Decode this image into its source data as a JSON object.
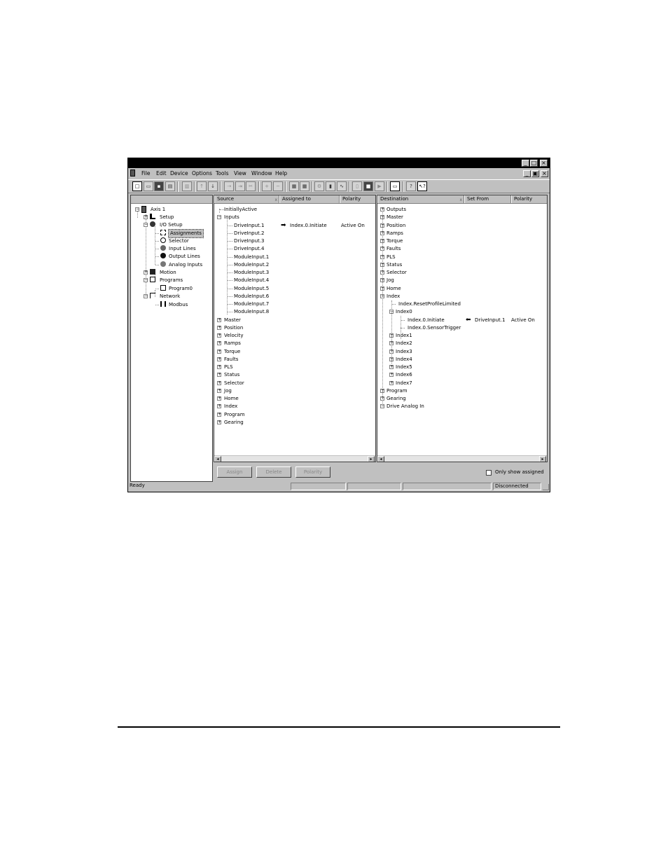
{
  "menu": {
    "items": [
      "File",
      "Edit",
      "Device",
      "Options",
      "Tools",
      "View",
      "Window",
      "Help"
    ]
  },
  "window_controls": {
    "minimize": "_",
    "maximize": "□",
    "close": "×",
    "restore": "▣"
  },
  "tree": {
    "items": [
      {
        "label": "Axis 1",
        "icon": "drive-icon"
      },
      {
        "label": "Setup",
        "icon": "setup-icon"
      },
      {
        "label": "I/O Setup",
        "icon": "io-setup-icon"
      },
      {
        "label": "Assignments",
        "icon": "assignments-icon"
      },
      {
        "label": "Selector",
        "icon": "selector-icon"
      },
      {
        "label": "Input Lines",
        "icon": "input-lines-icon"
      },
      {
        "label": "Output Lines",
        "icon": "output-lines-icon"
      },
      {
        "label": "Analog Inputs",
        "icon": "analog-inputs-icon"
      },
      {
        "label": "Motion",
        "icon": "motion-icon"
      },
      {
        "label": "Programs",
        "icon": "programs-icon"
      },
      {
        "label": "Program0",
        "icon": "program-icon"
      },
      {
        "label": "Network",
        "icon": "network-icon"
      },
      {
        "label": "Modbus",
        "icon": "modbus-icon"
      }
    ]
  },
  "source_panel": {
    "columns": [
      "Source",
      "Assigned to",
      "Polarity"
    ],
    "rows": [
      {
        "label": "InitiallyActive",
        "assigned": "",
        "polarity": ""
      },
      {
        "label": "Inputs",
        "assigned": "",
        "polarity": ""
      },
      {
        "label": "DriveInput.1",
        "assigned": "Index.0.Initiate",
        "polarity": "Active On"
      },
      {
        "label": "DriveInput.2",
        "assigned": "",
        "polarity": ""
      },
      {
        "label": "DriveInput.3",
        "assigned": "",
        "polarity": ""
      },
      {
        "label": "DriveInput.4",
        "assigned": "",
        "polarity": ""
      },
      {
        "label": "ModuleInput.1",
        "assigned": "",
        "polarity": ""
      },
      {
        "label": "ModuleInput.2",
        "assigned": "",
        "polarity": ""
      },
      {
        "label": "ModuleInput.3",
        "assigned": "",
        "polarity": ""
      },
      {
        "label": "ModuleInput.4",
        "assigned": "",
        "polarity": ""
      },
      {
        "label": "ModuleInput.5",
        "assigned": "",
        "polarity": ""
      },
      {
        "label": "ModuleInput.6",
        "assigned": "",
        "polarity": ""
      },
      {
        "label": "ModuleInput.7",
        "assigned": "",
        "polarity": ""
      },
      {
        "label": "ModuleInput.8",
        "assigned": "",
        "polarity": ""
      },
      {
        "label": "Master",
        "assigned": "",
        "polarity": ""
      },
      {
        "label": "Position",
        "assigned": "",
        "polarity": ""
      },
      {
        "label": "Velocity",
        "assigned": "",
        "polarity": ""
      },
      {
        "label": "Ramps",
        "assigned": "",
        "polarity": ""
      },
      {
        "label": "Torque",
        "assigned": "",
        "polarity": ""
      },
      {
        "label": "Faults",
        "assigned": "",
        "polarity": ""
      },
      {
        "label": "PLS",
        "assigned": "",
        "polarity": ""
      },
      {
        "label": "Status",
        "assigned": "",
        "polarity": ""
      },
      {
        "label": "Selector",
        "assigned": "",
        "polarity": ""
      },
      {
        "label": "Jog",
        "assigned": "",
        "polarity": ""
      },
      {
        "label": "Home",
        "assigned": "",
        "polarity": ""
      },
      {
        "label": "Index",
        "assigned": "",
        "polarity": ""
      },
      {
        "label": "Program",
        "assigned": "",
        "polarity": ""
      },
      {
        "label": "Gearing",
        "assigned": "",
        "polarity": ""
      }
    ]
  },
  "destination_panel": {
    "columns": [
      "Destination",
      "Set From",
      "Polarity"
    ],
    "rows": [
      {
        "label": "Outputs",
        "from": "",
        "polarity": ""
      },
      {
        "label": "Master",
        "from": "",
        "polarity": ""
      },
      {
        "label": "Position",
        "from": "",
        "polarity": ""
      },
      {
        "label": "Ramps",
        "from": "",
        "polarity": ""
      },
      {
        "label": "Torque",
        "from": "",
        "polarity": ""
      },
      {
        "label": "Faults",
        "from": "",
        "polarity": ""
      },
      {
        "label": "PLS",
        "from": "",
        "polarity": ""
      },
      {
        "label": "Status",
        "from": "",
        "polarity": ""
      },
      {
        "label": "Selector",
        "from": "",
        "polarity": ""
      },
      {
        "label": "Jog",
        "from": "",
        "polarity": ""
      },
      {
        "label": "Home",
        "from": "",
        "polarity": ""
      },
      {
        "label": "Index",
        "from": "",
        "polarity": ""
      },
      {
        "label": "Index.ResetProfileLimited",
        "from": "",
        "polarity": ""
      },
      {
        "label": "Index0",
        "from": "",
        "polarity": ""
      },
      {
        "label": "Index.0.Initiate",
        "from": "DriveInput.1",
        "polarity": "Active On"
      },
      {
        "label": "Index.0.SensorTrigger",
        "from": "",
        "polarity": ""
      },
      {
        "label": "Index1",
        "from": "",
        "polarity": ""
      },
      {
        "label": "Index2",
        "from": "",
        "polarity": ""
      },
      {
        "label": "Index3",
        "from": "",
        "polarity": ""
      },
      {
        "label": "Index4",
        "from": "",
        "polarity": ""
      },
      {
        "label": "Index5",
        "from": "",
        "polarity": ""
      },
      {
        "label": "Index6",
        "from": "",
        "polarity": ""
      },
      {
        "label": "Index7",
        "from": "",
        "polarity": ""
      },
      {
        "label": "Program",
        "from": "",
        "polarity": ""
      },
      {
        "label": "Gearing",
        "from": "",
        "polarity": ""
      },
      {
        "label": "Drive Analog In",
        "from": "",
        "polarity": ""
      }
    ]
  },
  "buttons": {
    "assign": "Assign",
    "delete": "Delete",
    "polarity": "Polarity"
  },
  "only_show_assigned": {
    "label": "Only show assigned",
    "checked": false
  },
  "status": {
    "left": "Ready",
    "connection": "Disconnected"
  },
  "icons": {
    "assign_arrow": "right-arrow-icon",
    "setfrom_arrow": "left-arrow-icon",
    "expand": "+",
    "collapse": "−"
  }
}
